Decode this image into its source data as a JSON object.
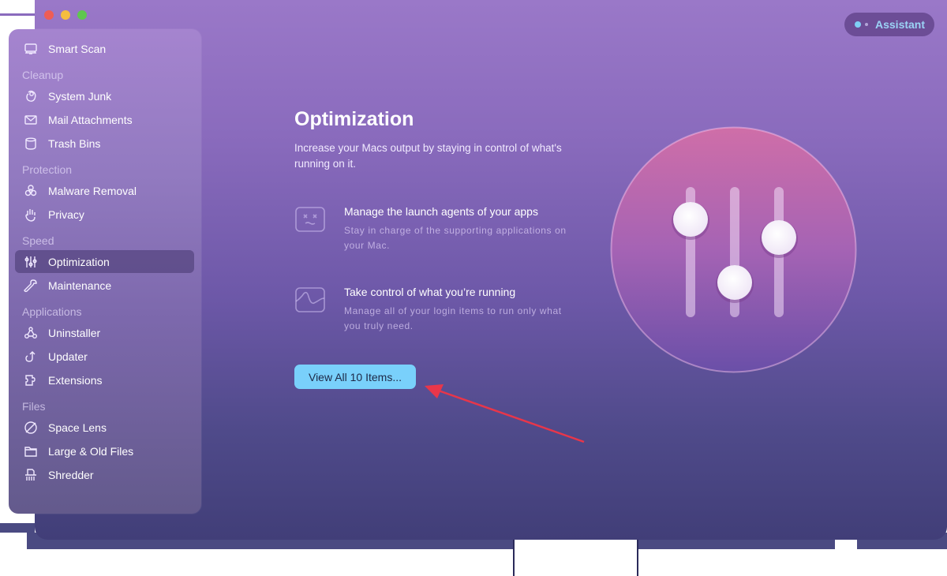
{
  "window": {
    "traffic_lights": [
      {
        "name": "close",
        "color": "#ee5d55"
      },
      {
        "name": "minimize",
        "color": "#f5bd3e"
      },
      {
        "name": "zoom",
        "color": "#5fc74f"
      }
    ]
  },
  "assistant": {
    "label": "Assistant"
  },
  "sidebar": {
    "top_item": {
      "label": "Smart Scan",
      "icon": "monitor-icon"
    },
    "sections": [
      {
        "title": "Cleanup",
        "items": [
          {
            "label": "System Junk",
            "icon": "system-junk-icon"
          },
          {
            "label": "Mail Attachments",
            "icon": "mail-icon"
          },
          {
            "label": "Trash Bins",
            "icon": "trash-icon"
          }
        ]
      },
      {
        "title": "Protection",
        "items": [
          {
            "label": "Malware Removal",
            "icon": "biohazard-icon"
          },
          {
            "label": "Privacy",
            "icon": "hand-icon"
          }
        ]
      },
      {
        "title": "Speed",
        "items": [
          {
            "label": "Optimization",
            "icon": "sliders-icon",
            "active": true
          },
          {
            "label": "Maintenance",
            "icon": "wrench-icon"
          }
        ]
      },
      {
        "title": "Applications",
        "items": [
          {
            "label": "Uninstaller",
            "icon": "uninstaller-icon"
          },
          {
            "label": "Updater",
            "icon": "updater-icon"
          },
          {
            "label": "Extensions",
            "icon": "puzzle-icon"
          }
        ]
      },
      {
        "title": "Files",
        "items": [
          {
            "label": "Space Lens",
            "icon": "planet-icon"
          },
          {
            "label": "Large & Old Files",
            "icon": "folder-icon"
          },
          {
            "label": "Shredder",
            "icon": "shredder-icon"
          }
        ]
      }
    ]
  },
  "main": {
    "title": "Optimization",
    "subtitle": "Increase your Macs output by staying in control of what's running on it.",
    "features": [
      {
        "title": "Manage the launch agents of your apps",
        "description": "Stay in charge of the supporting applications on your Mac.",
        "icon": "dead-face-icon"
      },
      {
        "title": "Take control of what you’re running",
        "description": "Manage all of your login items to run only what you truly need.",
        "icon": "waveform-icon"
      }
    ],
    "cta_label": "View All 10 Items...",
    "hero_icon": "sliders-hero-icon",
    "annotation_color": "#e8364a"
  }
}
